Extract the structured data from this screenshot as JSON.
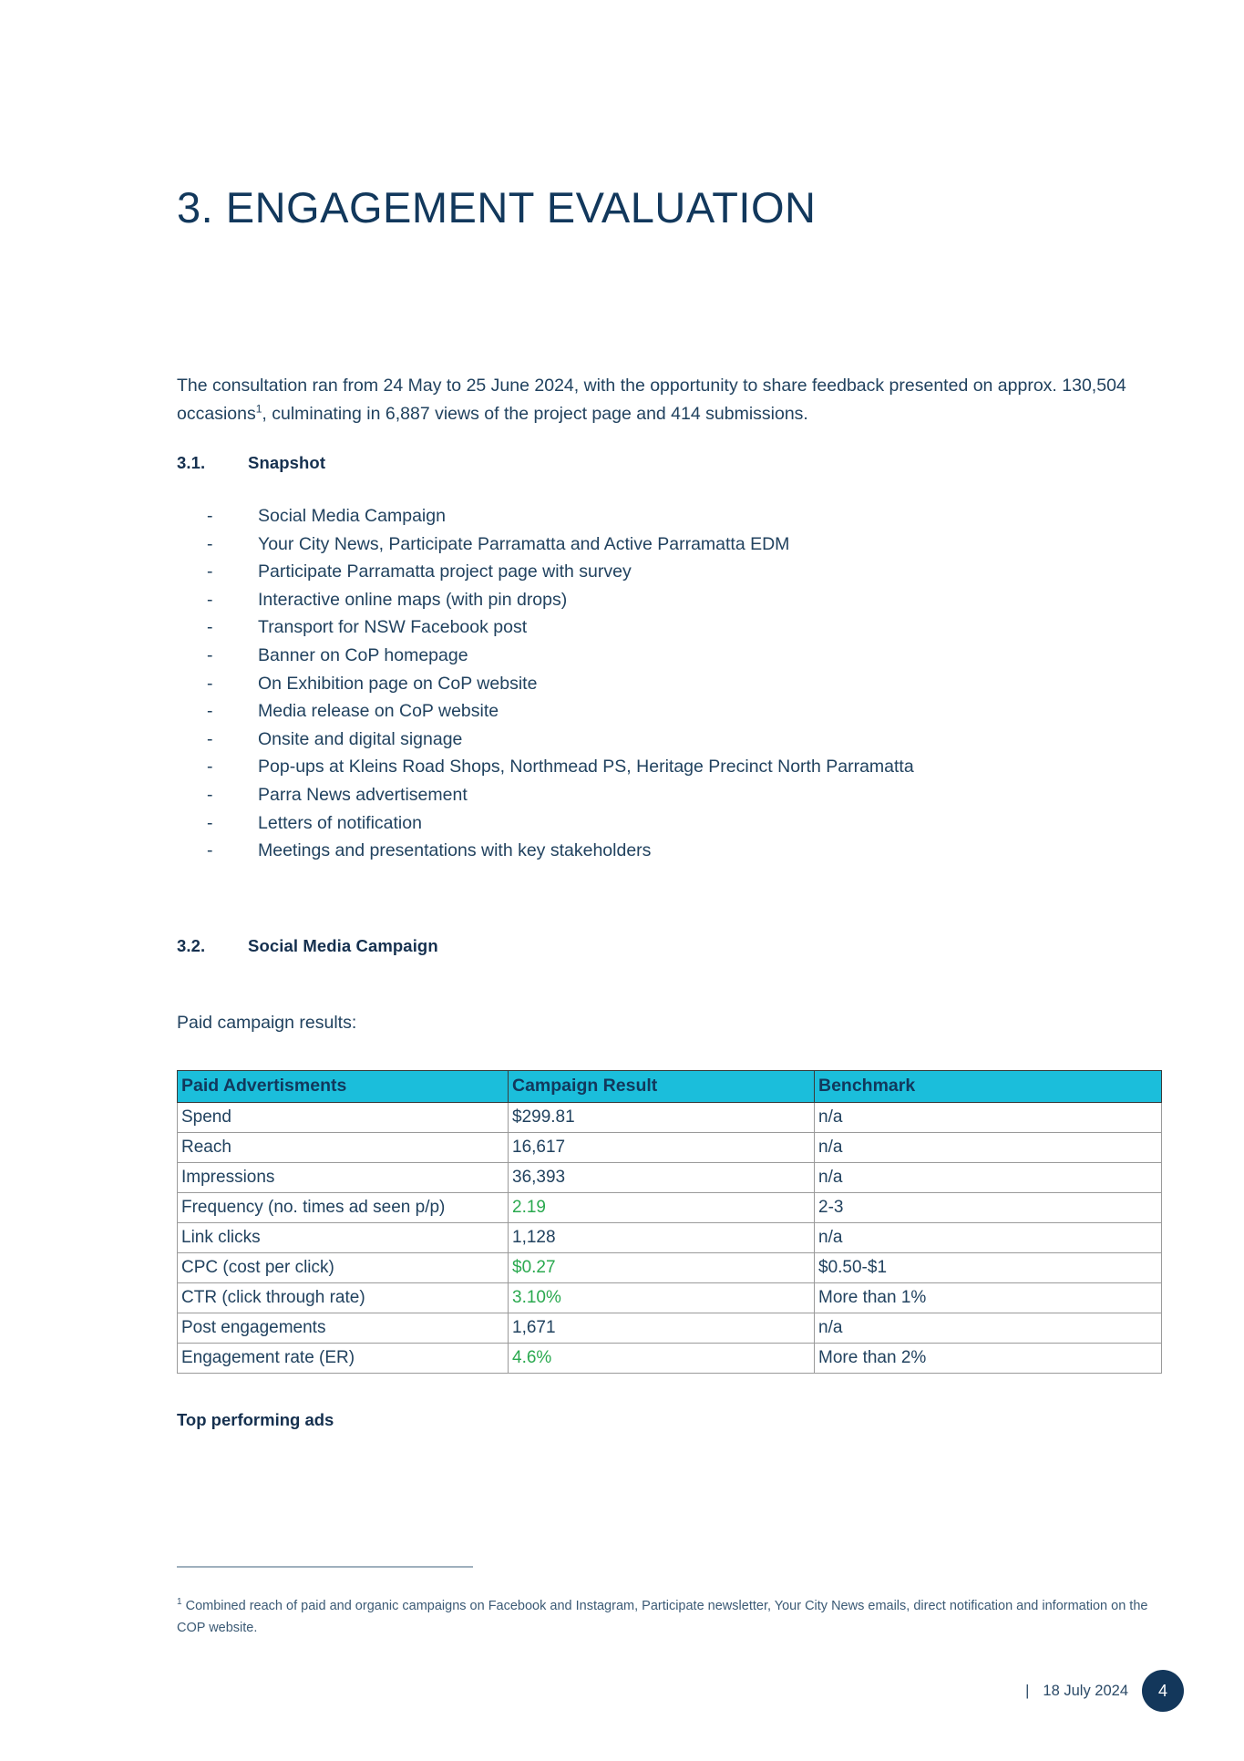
{
  "document": {
    "title": "3. ENGAGEMENT EVALUATION",
    "intro_before_sup": "The consultation ran from 24 May to 25 June 2024, with the opportunity to share feedback presented on approx. 130,504 occasions",
    "intro_sup": "1",
    "intro_after_sup": ", culminating in 6,887 views of the project page and 414 submissions."
  },
  "sections": {
    "snapshot": {
      "number": "3.1.",
      "title": "Snapshot",
      "items": [
        "Social Media Campaign",
        "Your City News, Participate Parramatta and Active Parramatta EDM",
        "Participate Parramatta project page with survey",
        "Interactive online maps (with pin drops)",
        "Transport for NSW Facebook post",
        "Banner on CoP homepage",
        "On Exhibition page on CoP website",
        "Media release on CoP website",
        "Onsite and digital signage",
        "Pop-ups at Kleins Road Shops, Northmead PS, Heritage Precinct North Parramatta",
        "Parra News advertisement",
        "Letters of notification",
        "Meetings and presentations with key stakeholders"
      ],
      "bullet_marker": "-"
    },
    "social_media": {
      "number": "3.2.",
      "title": "Social Media Campaign",
      "lead_in": "Paid campaign results:",
      "subhead": "Top performing ads"
    }
  },
  "table": {
    "headers": [
      "Paid Advertisments",
      "Campaign Result",
      "Benchmark"
    ],
    "header_bg": "#1bbedb",
    "highlight_color": "#2aa94f",
    "rows": [
      {
        "label": "Spend",
        "result": "$299.81",
        "benchmark": "n/a",
        "highlight": false
      },
      {
        "label": "Reach",
        "result": "16,617",
        "benchmark": "n/a",
        "highlight": false
      },
      {
        "label": "Impressions",
        "result": "36,393",
        "benchmark": "n/a",
        "highlight": false
      },
      {
        "label": "Frequency (no. times ad seen p/p)",
        "result": "2.19",
        "benchmark": "2-3",
        "highlight": true
      },
      {
        "label": "Link clicks",
        "result": "1,128",
        "benchmark": "n/a",
        "highlight": false
      },
      {
        "label": "CPC (cost per click)",
        "result": "$0.27",
        "benchmark": "$0.50-$1",
        "highlight": true
      },
      {
        "label": "CTR (click through rate)",
        "result": "3.10%",
        "benchmark": "More than 1%",
        "highlight": true
      },
      {
        "label": "Post engagements",
        "result": "1,671",
        "benchmark": "n/a",
        "highlight": false
      },
      {
        "label": "Engagement rate (ER)",
        "result": "4.6%",
        "benchmark": "More than 2%",
        "highlight": true
      }
    ]
  },
  "footnote": {
    "marker": "1",
    "text": "Combined reach of paid and organic campaigns on Facebook and Instagram, Participate newsletter, Your City News emails, direct notification and information on the COP website."
  },
  "footer": {
    "separator": "|",
    "date": "18 July 2024",
    "page_number": "4"
  }
}
